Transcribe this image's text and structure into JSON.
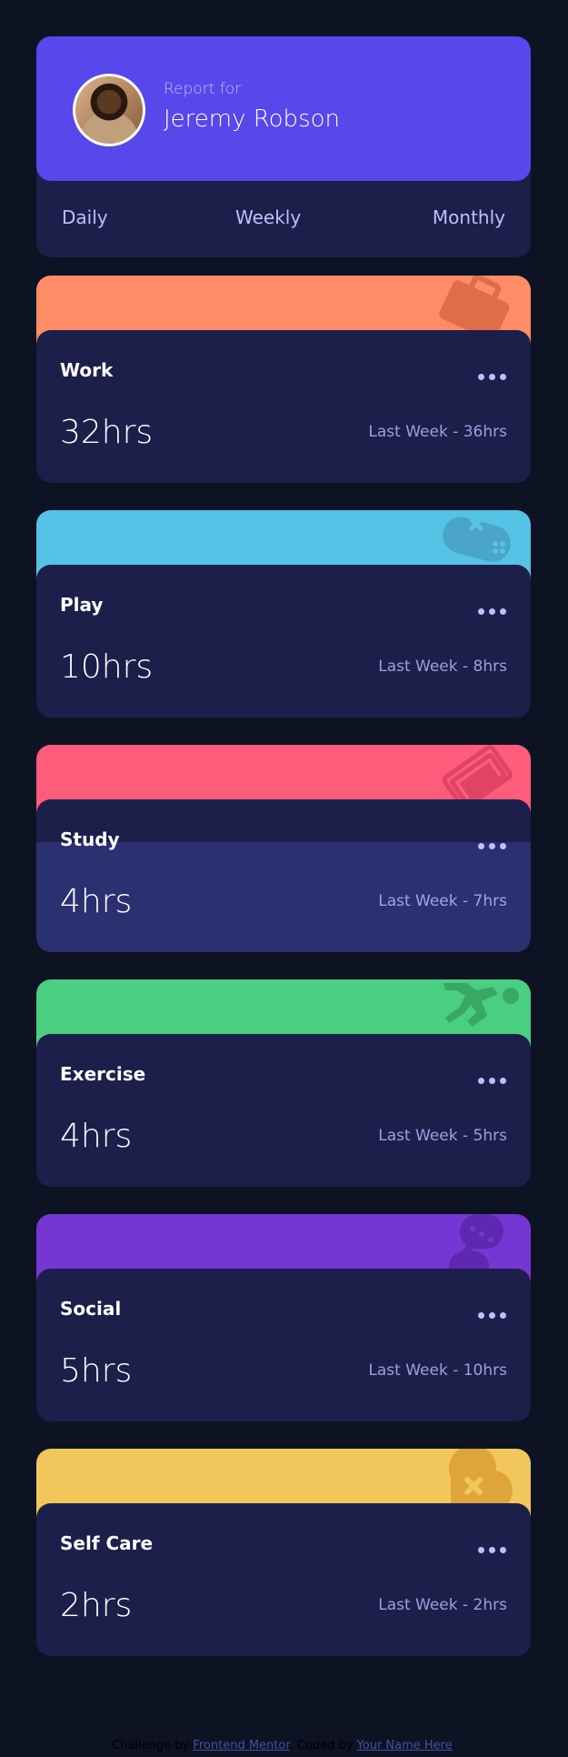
{
  "profile": {
    "report_for": "Report for",
    "name": "Jeremy Robson"
  },
  "tabs": [
    {
      "label": "Daily"
    },
    {
      "label": "Weekly"
    },
    {
      "label": "Monthly"
    }
  ],
  "activities": [
    {
      "title": "Work",
      "hours": "32hrs",
      "last_week": "Last Week - 36hrs",
      "color": "#ff8c66",
      "icon": "briefcase-icon"
    },
    {
      "title": "Play",
      "hours": "10hrs",
      "last_week": "Last Week - 8hrs",
      "color": "#56c2e6",
      "icon": "gamepad-icon"
    },
    {
      "title": "Study",
      "hours": "4hrs",
      "last_week": "Last Week - 7hrs",
      "color": "#ff5c7c",
      "icon": "book-icon"
    },
    {
      "title": "Exercise",
      "hours": "4hrs",
      "last_week": "Last Week - 5hrs",
      "color": "#4acf81",
      "icon": "runner-icon"
    },
    {
      "title": "Social",
      "hours": "5hrs",
      "last_week": "Last Week - 10hrs",
      "color": "#7536d3",
      "icon": "chat-icon"
    },
    {
      "title": "Self Care",
      "hours": "2hrs",
      "last_week": "Last Week - 2hrs",
      "color": "#f1c65b",
      "icon": "heart-icon"
    }
  ],
  "attribution": {
    "challenge_by": "Challenge by",
    "frontend_mentor": "Frontend Mentor",
    "coded_by": ". Coded by",
    "your_name": "Your Name Here",
    "end": "."
  }
}
